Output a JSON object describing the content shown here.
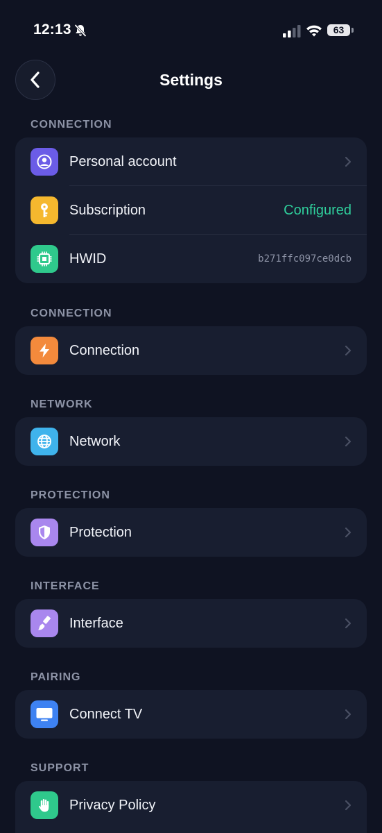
{
  "status_bar": {
    "time": "12:13",
    "battery": "63"
  },
  "header": {
    "title": "Settings"
  },
  "sections": [
    {
      "header": "CONNECTION",
      "rows": [
        {
          "label": "Personal account",
          "icon": "person-icon",
          "icon_color": "#6b5ce7"
        },
        {
          "label": "Subscription",
          "icon": "key-icon",
          "icon_color": "#f5b82e",
          "value": "Configured",
          "value_color": "#2fcf9c"
        },
        {
          "label": "HWID",
          "icon": "chip-icon",
          "icon_color": "#2fc98c",
          "value": "b271ffc097ce0dcb"
        }
      ]
    },
    {
      "header": "CONNECTION",
      "rows": [
        {
          "label": "Connection",
          "icon": "lightning-icon",
          "icon_color": "#f38a3c"
        }
      ]
    },
    {
      "header": "NETWORK",
      "rows": [
        {
          "label": "Network",
          "icon": "globe-icon",
          "icon_color": "#3fb3ec"
        }
      ]
    },
    {
      "header": "PROTECTION",
      "rows": [
        {
          "label": "Protection",
          "icon": "shield-icon",
          "icon_color": "#a987ee"
        }
      ]
    },
    {
      "header": "INTERFACE",
      "rows": [
        {
          "label": "Interface",
          "icon": "brush-icon",
          "icon_color": "#a987ee"
        }
      ]
    },
    {
      "header": "PAIRING",
      "rows": [
        {
          "label": "Connect TV",
          "icon": "tv-icon",
          "icon_color": "#3e82f2"
        }
      ]
    },
    {
      "header": "SUPPORT",
      "rows": [
        {
          "label": "Privacy Policy",
          "icon": "hand-icon",
          "icon_color": "#2fc98c"
        }
      ]
    }
  ]
}
